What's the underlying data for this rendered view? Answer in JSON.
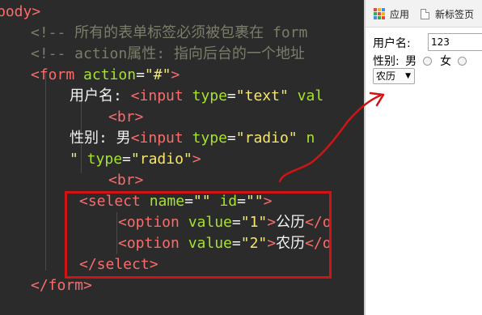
{
  "editor": {
    "code_lines": [
      {
        "tokens": [
          {
            "c": "tag",
            "t": "body>"
          }
        ]
      },
      {
        "tokens": [
          {
            "c": "cmt",
            "t": "<!-- 所有的表单标签必须被包裹在 form"
          }
        ]
      },
      {
        "tokens": [
          {
            "c": "cmt",
            "t": "<!-- action属性: 指向后台的一个地址"
          }
        ]
      },
      {
        "tokens": [
          {
            "c": "tag",
            "t": "<form"
          },
          {
            "c": "pun",
            "t": " "
          },
          {
            "c": "attr",
            "t": "action"
          },
          {
            "c": "pun",
            "t": "="
          },
          {
            "c": "str",
            "t": "\"#\""
          },
          {
            "c": "tag",
            "t": ">"
          }
        ]
      },
      {
        "tokens": [
          {
            "c": "txt",
            "t": "用户名: "
          },
          {
            "c": "tag",
            "t": "<input"
          },
          {
            "c": "pun",
            "t": " "
          },
          {
            "c": "attr",
            "t": "type"
          },
          {
            "c": "pun",
            "t": "="
          },
          {
            "c": "str",
            "t": "\"text\""
          },
          {
            "c": "pun",
            "t": " "
          },
          {
            "c": "attr",
            "t": "val"
          }
        ]
      },
      {
        "tokens": [
          {
            "c": "tag",
            "t": "<br>"
          }
        ]
      },
      {
        "tokens": [
          {
            "c": "txt",
            "t": "性别: 男"
          },
          {
            "c": "tag",
            "t": "<input"
          },
          {
            "c": "pun",
            "t": " "
          },
          {
            "c": "attr",
            "t": "type"
          },
          {
            "c": "pun",
            "t": "="
          },
          {
            "c": "str",
            "t": "\"radio\""
          },
          {
            "c": "pun",
            "t": " "
          },
          {
            "c": "attr",
            "t": "n"
          }
        ]
      },
      {
        "tokens": [
          {
            "c": "str",
            "t": "\""
          },
          {
            "c": "pun",
            "t": " "
          },
          {
            "c": "attr",
            "t": "type"
          },
          {
            "c": "pun",
            "t": "="
          },
          {
            "c": "str",
            "t": "\"radio\""
          },
          {
            "c": "tag",
            "t": ">"
          }
        ]
      },
      {
        "tokens": [
          {
            "c": "tag",
            "t": "<br>"
          }
        ]
      },
      {
        "tokens": [
          {
            "c": "tag",
            "t": "<select"
          },
          {
            "c": "pun",
            "t": " "
          },
          {
            "c": "attr",
            "t": "name"
          },
          {
            "c": "pun",
            "t": "="
          },
          {
            "c": "str",
            "t": "\"\""
          },
          {
            "c": "pun",
            "t": " "
          },
          {
            "c": "attr",
            "t": "id"
          },
          {
            "c": "pun",
            "t": "="
          },
          {
            "c": "str",
            "t": "\"\""
          },
          {
            "c": "tag",
            "t": ">"
          }
        ]
      },
      {
        "tokens": [
          {
            "c": "tag",
            "t": "<option"
          },
          {
            "c": "pun",
            "t": " "
          },
          {
            "c": "attr",
            "t": "value"
          },
          {
            "c": "pun",
            "t": "="
          },
          {
            "c": "str",
            "t": "\"1\""
          },
          {
            "c": "tag",
            "t": ">"
          },
          {
            "c": "txt",
            "t": "公历"
          },
          {
            "c": "tag",
            "t": "</o"
          }
        ]
      },
      {
        "tokens": [
          {
            "c": "tag",
            "t": "<option"
          },
          {
            "c": "pun",
            "t": " "
          },
          {
            "c": "attr",
            "t": "value"
          },
          {
            "c": "pun",
            "t": "="
          },
          {
            "c": "str",
            "t": "\"2\""
          },
          {
            "c": "tag",
            "t": ">"
          },
          {
            "c": "txt",
            "t": "农历"
          },
          {
            "c": "tag",
            "t": "</o"
          }
        ]
      },
      {
        "tokens": [
          {
            "c": "tag",
            "t": "</select>"
          }
        ]
      },
      {
        "tokens": [
          {
            "c": "tag",
            "t": "</form>"
          }
        ]
      }
    ]
  },
  "browser": {
    "bookmarks": {
      "apps_label": "应用",
      "new_tab_label": "新标签页"
    },
    "form": {
      "username_label": "用户名:",
      "username_value": "123",
      "gender_label": "性别:",
      "male_label": "男",
      "female_label": "女",
      "calendar_selected": "农历"
    }
  },
  "colors": {
    "annotation": "#d01414",
    "editor_bg": "#2b2b2b",
    "tag": "#ff6a6a",
    "attr": "#a6e22e",
    "string": "#f5e66e",
    "comment": "#7c7c6a"
  }
}
